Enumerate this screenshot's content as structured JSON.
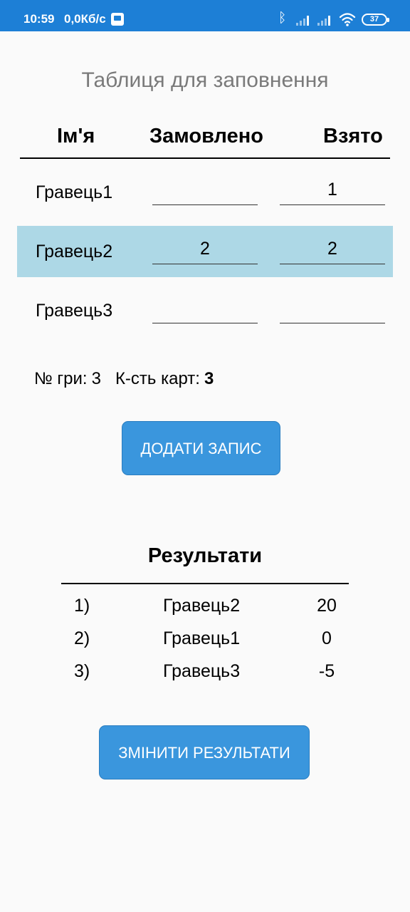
{
  "status_bar": {
    "time": "10:59",
    "speed": "0,0Кб/с",
    "battery": "37",
    "icons": [
      "notification-icon",
      "bluetooth-icon",
      "signal-icon",
      "signal-icon",
      "wifi-icon",
      "battery-icon"
    ],
    "color": "#1d7fd6"
  },
  "screen_title": "Таблиця для заповнення",
  "table": {
    "headers": {
      "name": "Ім'я",
      "ordered": "Замовлено",
      "taken": "Взято"
    },
    "rows": [
      {
        "name": "Гравець1",
        "ordered": "",
        "taken": "1",
        "highlighted": false
      },
      {
        "name": "Гравець2",
        "ordered": "2",
        "taken": "2",
        "highlighted": true
      },
      {
        "name": "Гравець3",
        "ordered": "",
        "taken": "",
        "highlighted": false
      }
    ],
    "highlight_color": "#add8e6"
  },
  "game_info": {
    "game_label": "№ гри:",
    "game_value": "3",
    "cards_label": "К-сть карт:",
    "cards_value": "3"
  },
  "add_button_label": "ДОДАТИ ЗАПИС",
  "results": {
    "title": "Результати",
    "rows": [
      {
        "place": "1)",
        "name": "Гравець2",
        "score": "20"
      },
      {
        "place": "2)",
        "name": "Гравець1",
        "score": "0"
      },
      {
        "place": "3)",
        "name": "Гравець3",
        "score": "-5"
      }
    ]
  },
  "change_button_label": "ЗМІНИТИ РЕЗУЛЬТАТИ",
  "accent_color": "#3a96dd"
}
